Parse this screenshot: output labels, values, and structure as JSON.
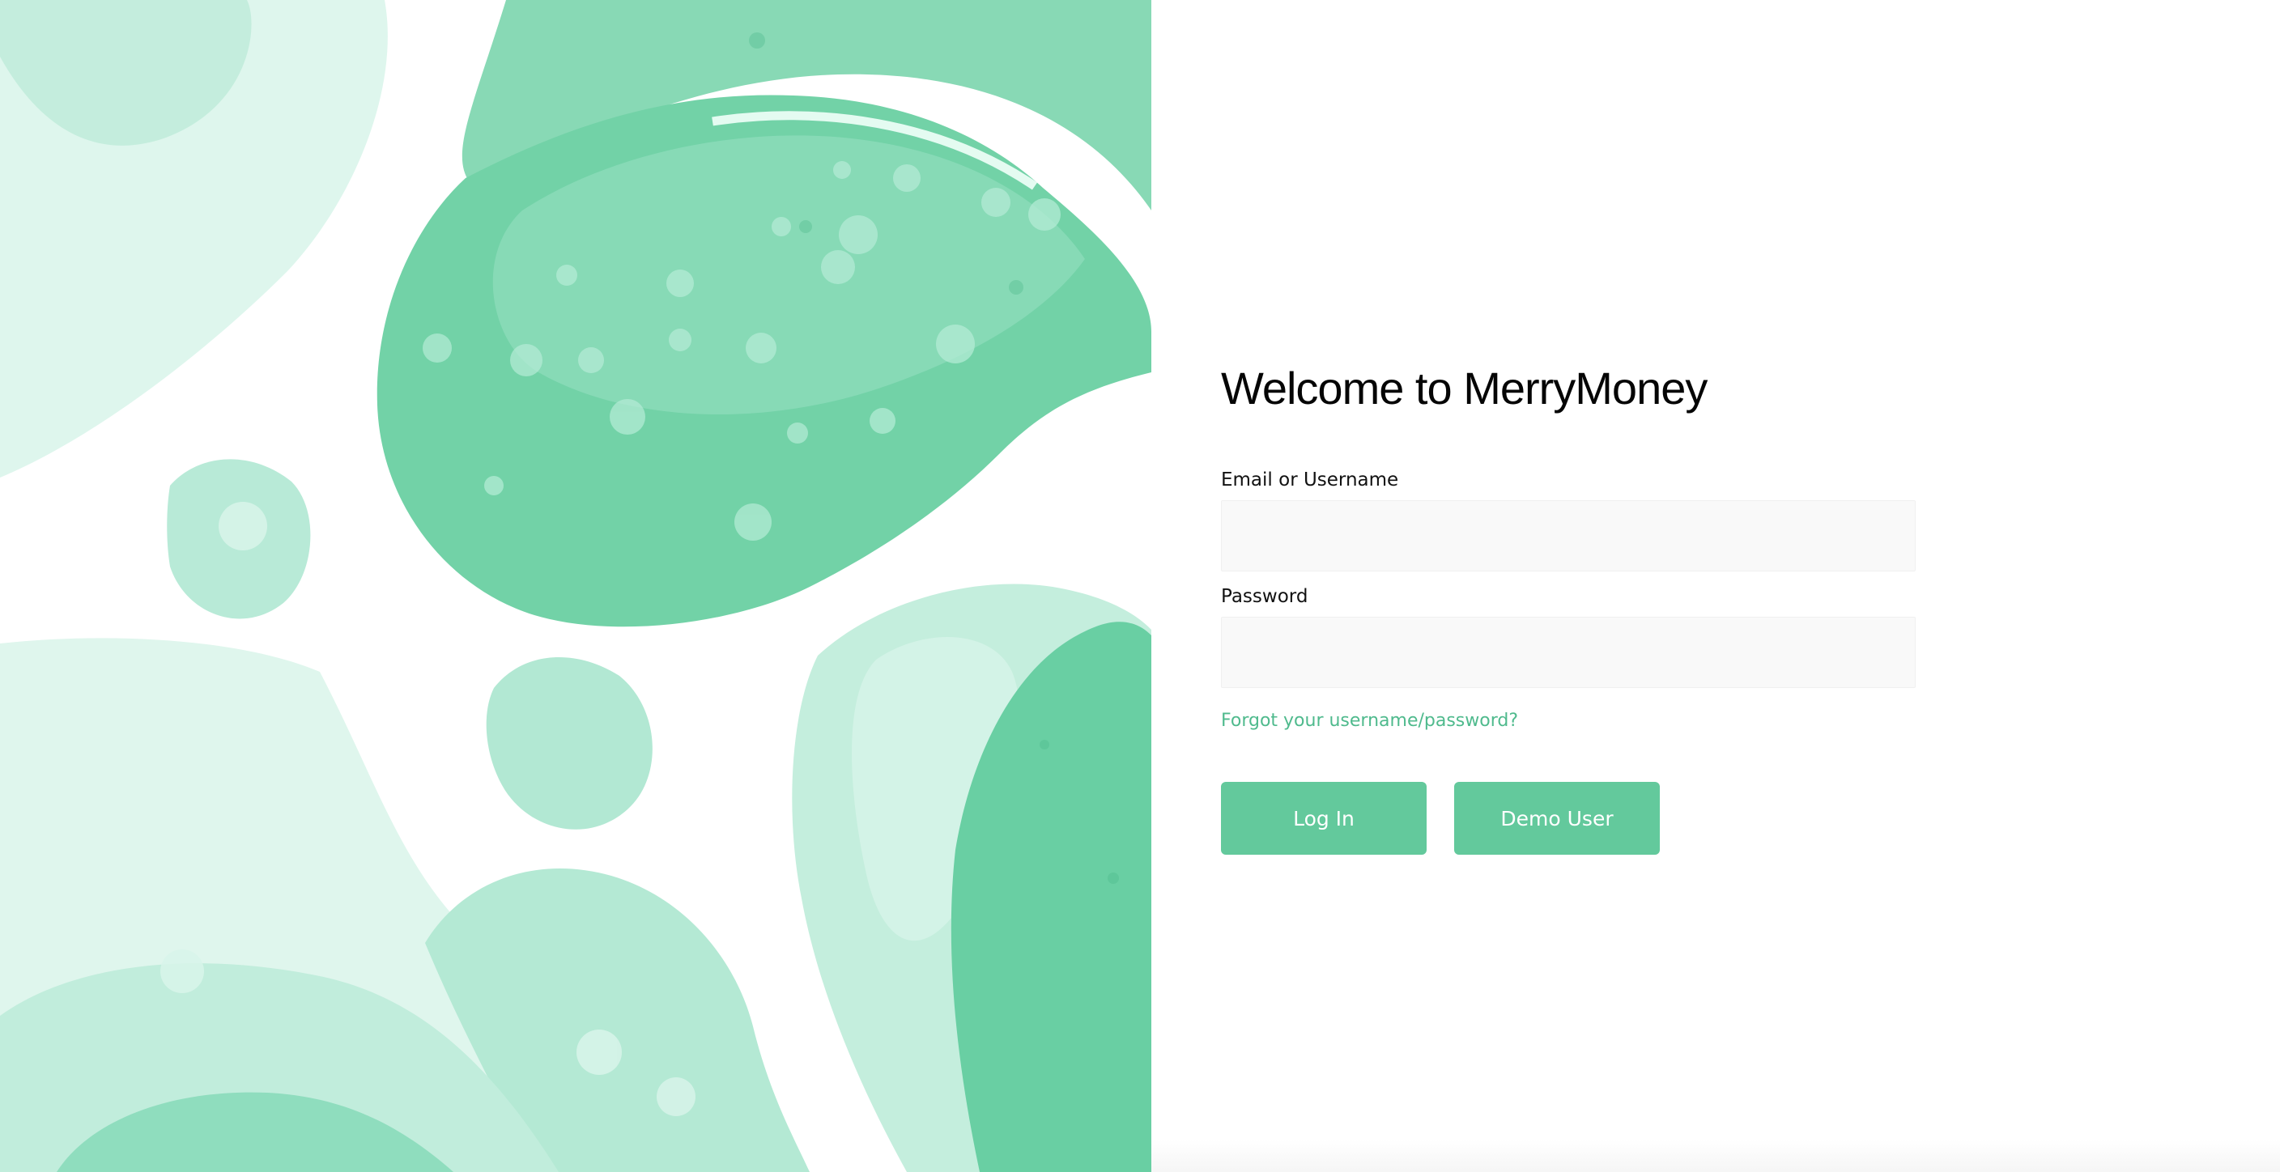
{
  "title": "Welcome to MerryMoney",
  "login_form": {
    "email_label": "Email or Username",
    "email_value": "",
    "email_placeholder": "",
    "password_label": "Password",
    "password_value": "",
    "password_placeholder": "",
    "forgot_link": "Forgot your username/password?",
    "login_button": "Log In",
    "demo_button": "Demo User"
  },
  "colors": {
    "accent": "#63c99c",
    "link": "#4fba8d",
    "input_background": "#f9f9f9",
    "artwork_light": "#d8f3e8",
    "artwork_dark": "#67cfa5"
  },
  "artwork": {
    "icon": "green-fluid-art"
  }
}
